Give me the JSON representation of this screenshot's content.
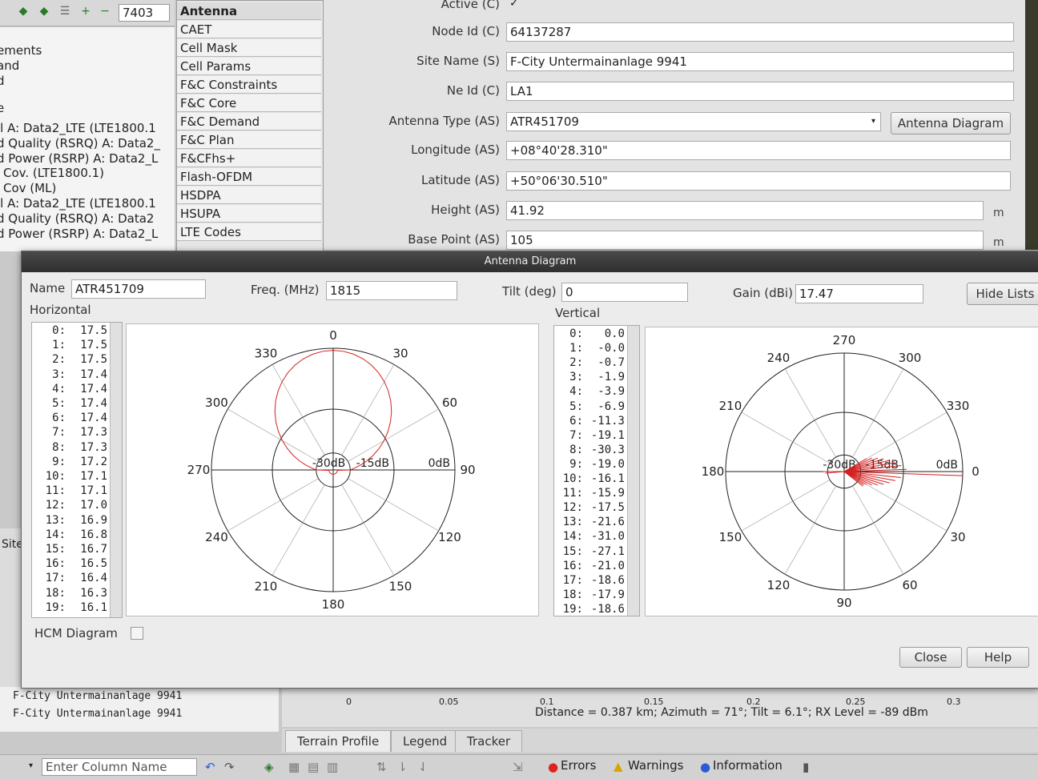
{
  "toolbar": {
    "id_value": "7403"
  },
  "tree": {
    "lines": [
      "ements",
      "and",
      "d",
      "e",
      "ll A: Data2_LTE (LTE1800.1",
      "d Quality (RSRQ) A: Data2_",
      "d Power (RSRP) A: Data2_L",
      "Cov. (LTE1800.1)",
      "Cov (ML)",
      "ll A: Data2_LTE (LTE1800.1",
      "d Quality (RSRQ) A: Data2",
      "d Power (RSRP) A: Data2_L"
    ]
  },
  "categories": {
    "items": [
      "Antenna",
      "CAET",
      "Cell Mask",
      "Cell Params",
      "F&C Constraints",
      "F&C Core",
      "F&C Demand",
      "F&C Plan",
      "F&CFhs+",
      "Flash-OFDM",
      "HSDPA",
      "HSUPA",
      "LTE Codes"
    ]
  },
  "props": {
    "active_label": "Active (C)",
    "active_value": "✓",
    "node_id_label": "Node Id (C)",
    "node_id": "64137287",
    "site_name_label": "Site Name (S)",
    "site_name": "F-City Untermainanlage 9941",
    "ne_id_label": "Ne Id (C)",
    "ne_id": "LA1",
    "antenna_type_label": "Antenna Type (AS)",
    "antenna_type": "ATR451709",
    "antenna_diagram_button": "Antenna Diagram",
    "longitude_label": "Longitude (AS)",
    "longitude": "+08°40'28.310\"",
    "latitude_label": "Latitude (AS)",
    "latitude": "+50°06'30.510\"",
    "height_label": "Height (AS)",
    "height": "41.92",
    "height_unit": "m",
    "base_point_label": "Base Point (AS)",
    "base_point": "105",
    "base_point_unit": "m"
  },
  "dialog": {
    "title": "Antenna Diagram",
    "name_label": "Name",
    "name": "ATR451709",
    "freq_label": "Freq. (MHz)",
    "freq": "1815",
    "tilt_label": "Tilt (deg)",
    "tilt": "0",
    "gain_label": "Gain (dBi)",
    "gain": "17.47",
    "hide_lists_button": "Hide Lists",
    "horizontal_label": "Horizontal",
    "vertical_label": "Vertical",
    "hcm_label": "HCM Diagram",
    "close_button": "Close",
    "help_button": "Help",
    "horizontal_values": [
      [
        "0:",
        "17.5"
      ],
      [
        "1:",
        "17.5"
      ],
      [
        "2:",
        "17.5"
      ],
      [
        "3:",
        "17.4"
      ],
      [
        "4:",
        "17.4"
      ],
      [
        "5:",
        "17.4"
      ],
      [
        "6:",
        "17.4"
      ],
      [
        "7:",
        "17.3"
      ],
      [
        "8:",
        "17.3"
      ],
      [
        "9:",
        "17.2"
      ],
      [
        "10:",
        "17.1"
      ],
      [
        "11:",
        "17.1"
      ],
      [
        "12:",
        "17.0"
      ],
      [
        "13:",
        "16.9"
      ],
      [
        "14:",
        "16.8"
      ],
      [
        "15:",
        "16.7"
      ],
      [
        "16:",
        "16.5"
      ],
      [
        "17:",
        "16.4"
      ],
      [
        "18:",
        "16.3"
      ],
      [
        "19:",
        "16.1"
      ]
    ],
    "vertical_values": [
      [
        "0:",
        "0.0"
      ],
      [
        "1:",
        "-0.0"
      ],
      [
        "2:",
        "-0.7"
      ],
      [
        "3:",
        "-1.9"
      ],
      [
        "4:",
        "-3.9"
      ],
      [
        "5:",
        "-6.9"
      ],
      [
        "6:",
        "-11.3"
      ],
      [
        "7:",
        "-19.1"
      ],
      [
        "8:",
        "-30.3"
      ],
      [
        "9:",
        "-19.0"
      ],
      [
        "10:",
        "-16.1"
      ],
      [
        "11:",
        "-15.9"
      ],
      [
        "12:",
        "-17.5"
      ],
      [
        "13:",
        "-21.6"
      ],
      [
        "14:",
        "-31.0"
      ],
      [
        "15:",
        "-27.1"
      ],
      [
        "16:",
        "-21.0"
      ],
      [
        "17:",
        "-18.6"
      ],
      [
        "18:",
        "-17.9"
      ],
      [
        "19:",
        "-18.6"
      ]
    ],
    "h_angles": [
      "0",
      "30",
      "60",
      "90",
      "120",
      "150",
      "180",
      "210",
      "240",
      "270",
      "300",
      "330"
    ],
    "v_angles": [
      "270",
      "300",
      "330",
      "0",
      "30",
      "60",
      "90",
      "120",
      "150",
      "180",
      "210",
      "240"
    ],
    "ring_labels": [
      "-30dB",
      "-15dB",
      "0dB"
    ]
  },
  "bottom": {
    "site_header": "Site",
    "sites": [
      "F-City Untermainanlage 9941",
      "F-City Untermainanlage 9941"
    ],
    "x_ticks": [
      "0",
      "0.05",
      "0.1",
      "0.15",
      "0.2",
      "0.25",
      "0.3"
    ],
    "readout": "Distance = 0.387 km; Azimuth = 71°; Tilt = 6.1°; RX Level = -89 dBm",
    "tabs": [
      "Terrain Profile",
      "Legend",
      "Tracker"
    ]
  },
  "status": {
    "column_placeholder": "Enter Column Name",
    "errors": "Errors",
    "warnings": "Warnings",
    "information": "Information"
  },
  "colors": {
    "pattern": "#d42020",
    "titlebar": "#333333",
    "grid": "#222222"
  }
}
